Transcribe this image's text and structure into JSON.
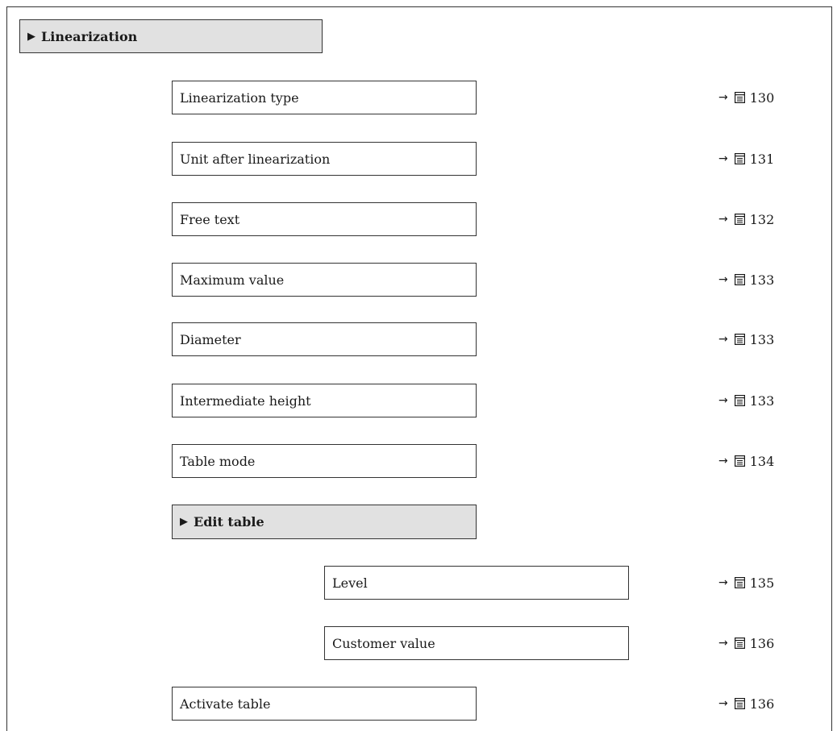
{
  "section": {
    "title": "Linearization"
  },
  "parameters": [
    {
      "label": "Linearization type",
      "page": "130"
    },
    {
      "label": "Unit after linearization",
      "page": "131"
    },
    {
      "label": "Free text",
      "page": "132"
    },
    {
      "label": "Maximum value",
      "page": "133"
    },
    {
      "label": "Diameter",
      "page": "133"
    },
    {
      "label": "Intermediate height",
      "page": "133"
    },
    {
      "label": "Table mode",
      "page": "134"
    }
  ],
  "submenu": {
    "title": "Edit table",
    "parameters": [
      {
        "label": "Level",
        "page": "135"
      },
      {
        "label": "Customer value",
        "page": "136"
      }
    ]
  },
  "trailing_parameter": {
    "label": "Activate table",
    "page": "136"
  },
  "icons": {
    "expand": "triangle-right-icon",
    "reference_arrow": "arrow-right-icon",
    "page_reference": "book-page-icon"
  }
}
